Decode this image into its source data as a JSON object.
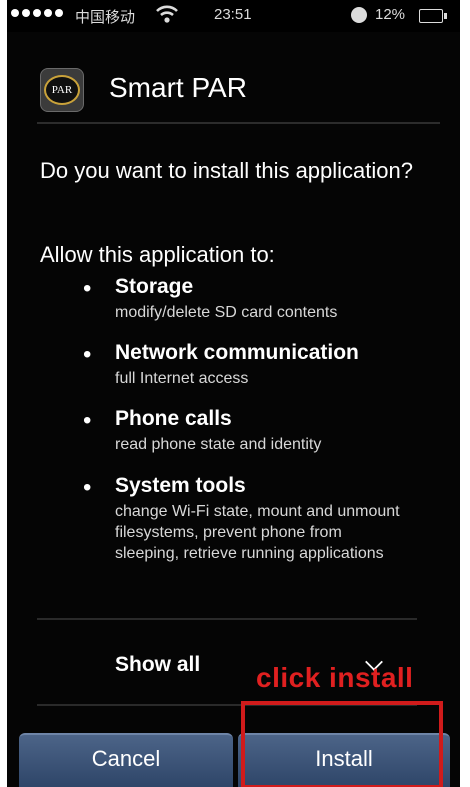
{
  "status_bar": {
    "carrier": "中国移动",
    "time": "23:51",
    "battery": "12%"
  },
  "app": {
    "name": "Smart PAR",
    "icon_text": "PAR"
  },
  "question": "Do you want to install this application?",
  "allow_heading": "Allow this application to:",
  "permissions": [
    {
      "title": "Storage",
      "desc": "modify/delete SD card contents"
    },
    {
      "title": "Network communication",
      "desc": "full Internet access"
    },
    {
      "title": "Phone calls",
      "desc": "read phone state and identity"
    },
    {
      "title": "System tools",
      "desc": "change Wi-Fi state, mount and unmount filesystems, prevent phone from sleeping, retrieve running applications"
    }
  ],
  "show_all": "Show all",
  "buttons": {
    "cancel": "Cancel",
    "install": "Install"
  },
  "annotation": {
    "text": "click install",
    "color": "#d01b1b"
  },
  "colors": {
    "button_top": "#4c6488",
    "button_bottom": "#2c4366"
  },
  "icons": {
    "wifi": "wifi-icon",
    "alarm": "alarm-icon",
    "battery": "battery-icon",
    "chevron": "chevron-down-icon"
  }
}
